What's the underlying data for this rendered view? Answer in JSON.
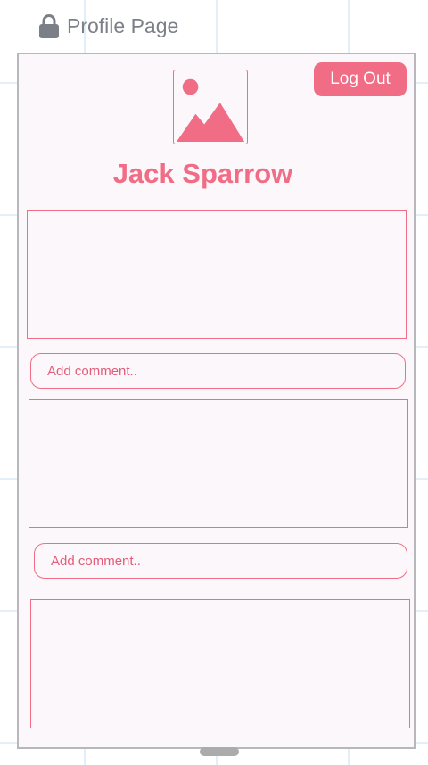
{
  "header": {
    "title": "Profile Page",
    "icon": "lock-icon"
  },
  "profile": {
    "name": "Jack Sparrow",
    "avatar_icon": "image-placeholder-icon",
    "logout_label": "Log Out"
  },
  "feed": {
    "posts": [
      {
        "comment_placeholder": "Add comment.."
      },
      {
        "comment_placeholder": "Add comment.."
      },
      {}
    ]
  },
  "colors": {
    "accent": "#f06d85",
    "frame_border": "#b8b8bc",
    "frame_background": "#fcf7fa",
    "header_text": "#7b7f88",
    "grid": "#e3eff8"
  }
}
